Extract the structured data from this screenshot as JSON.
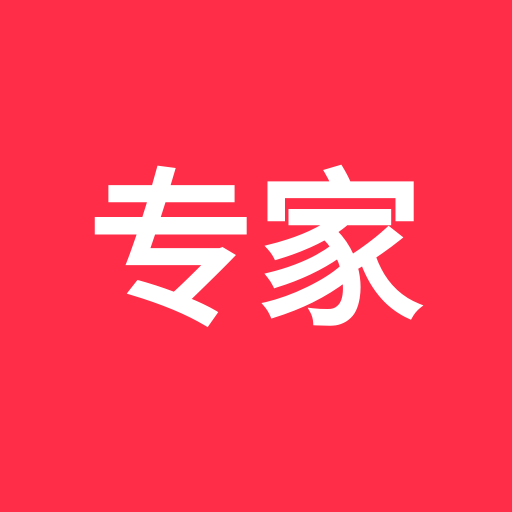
{
  "icon": {
    "label": "专家",
    "background_color": "#ff2d47",
    "text_color": "#ffffff"
  }
}
